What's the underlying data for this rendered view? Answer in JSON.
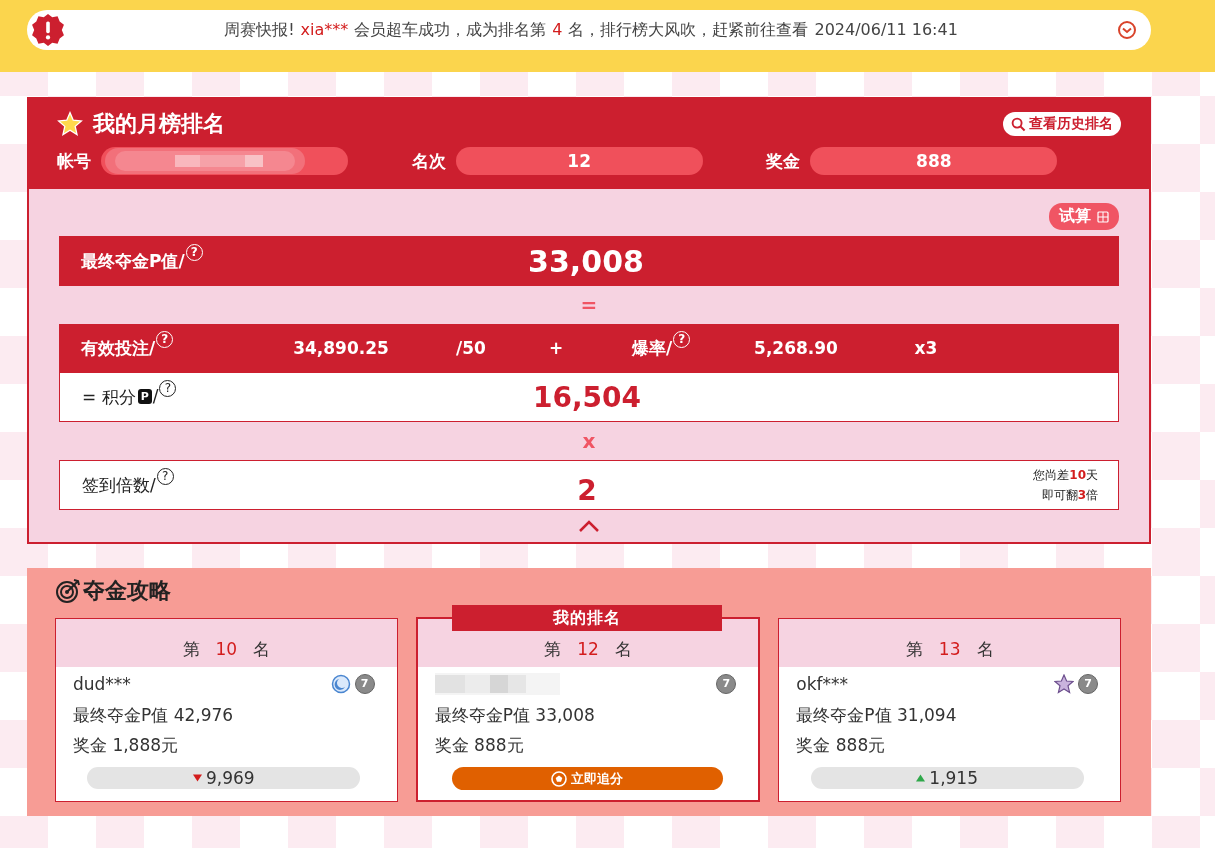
{
  "banner": {
    "label": "周赛快报!",
    "user": "xia***",
    "text": "会员超车成功，成为排名第",
    "rank": "4",
    "suffix": "名，排行榜大风吹，赶紧前往查看",
    "time": "2024/06/11 16:41"
  },
  "ranking": {
    "title": "我的月榜排名",
    "history_button": "查看历史排名",
    "fields": [
      {
        "kind": "blurred",
        "label": "帐号"
      },
      {
        "kind": "value",
        "label": "名次",
        "value": "12"
      },
      {
        "kind": "value",
        "label": "奖金",
        "value": "888"
      }
    ]
  },
  "calc": {
    "trial_button": "试算",
    "final_label": "最终夺金P值/",
    "final_help": "?",
    "bet_help": "?",
    "rate_help": "?",
    "points_help": "?",
    "checkin_help": "?",
    "final_value": "33,008",
    "op1": "=",
    "bet_label": "有效投注/",
    "bet_value": "34,890.25",
    "bet_div": "/50",
    "plus": "+",
    "rate_label": "爆率/",
    "rate_value": "5,268.90",
    "rate_mult": "x3",
    "points_prefix": "= 积分",
    "points_badge": "P",
    "points_slash": "/",
    "points_value": "16,504",
    "op2": "x",
    "checkin_label": "签到倍数/",
    "checkin_value": "2",
    "checkin_note": [
      "您尚差**10**天",
      "即可翻**3**倍"
    ]
  },
  "strategy": {
    "title": "夺金攻略",
    "cards": [
      {
        "kind": "other",
        "rank_prefix": "第",
        "rank": "10",
        "rank_suffix": "名",
        "name": "dud***",
        "badge": {
          "kind": "moon"
        },
        "level": "7",
        "value": "最终夺金P值 42,976",
        "prize": "奖金 1,888元",
        "diff": {
          "kind": "down",
          "value": "9,969"
        }
      },
      {
        "kind": "mine",
        "header": "我的排名",
        "rank_prefix": "第",
        "rank": "12",
        "rank_suffix": "名",
        "level": "7",
        "value": "最终夺金P值 33,008",
        "prize": "奖金 888元",
        "action": "立即追分"
      },
      {
        "kind": "other",
        "rank_prefix": "第",
        "rank": "13",
        "rank_suffix": "名",
        "name": "okf***",
        "badge": {
          "kind": "star"
        },
        "level": "7",
        "value": "最终夺金P值 31,094",
        "prize": "奖金 888元",
        "diff": {
          "kind": "up",
          "value": "1,915"
        }
      }
    ]
  }
}
